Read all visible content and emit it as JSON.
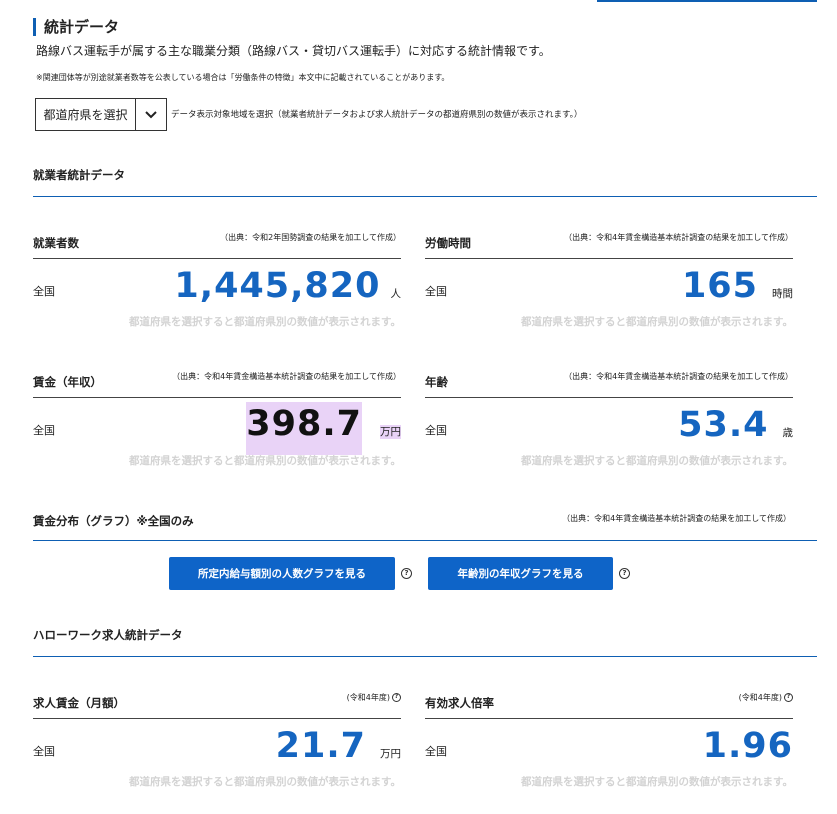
{
  "header": {
    "title": "統計データ",
    "description": "路線バス運転手が属する主な職業分類（路線バス・貸切バス運転手）に対応する統計情報です。",
    "note": "※関連団体等が別途就業者数等を公表している場合は「労働条件の特徴」本文中に記載されていることがあります。"
  },
  "region_select": {
    "label": "都道府県を選択",
    "hint": "データ表示対象地域を選択（就業者統計データおよび求人統計データの都道府県別の数値が表示されます。）"
  },
  "employment_section": {
    "title": "就業者統計データ"
  },
  "cards": {
    "workers": {
      "title": "就業者数",
      "source": "（出典：令和2年国勢調査の結果を加工して作成）",
      "region": "全国",
      "value": "1,445,820",
      "unit": "人",
      "note": "都道府県を選択すると都道府県別の数値が表示されます。"
    },
    "hours": {
      "title": "労働時間",
      "source": "（出典：令和4年賃金構造基本統計調査の結果を加工して作成）",
      "region": "全国",
      "value": "165",
      "unit": "時間",
      "note": "都道府県を選択すると都道府県別の数値が表示されます。"
    },
    "wage": {
      "title": "賃金（年収）",
      "source": "（出典：令和4年賃金構造基本統計調査の結果を加工して作成）",
      "region": "全国",
      "value": "398.7",
      "unit": "万円",
      "note": "都道府県を選択すると都道府県別の数値が表示されます。"
    },
    "age": {
      "title": "年齢",
      "source": "（出典：令和4年賃金構造基本統計調査の結果を加工して作成）",
      "region": "全国",
      "value": "53.4",
      "unit": "歳",
      "note": "都道府県を選択すると都道府県別の数値が表示されます。"
    },
    "job_wage": {
      "title": "求人賃金（月額）",
      "source": "(令和4年度)",
      "region": "全国",
      "value": "21.7",
      "unit": "万円",
      "note": "都道府県を選択すると都道府県別の数値が表示されます。"
    },
    "job_ratio": {
      "title": "有効求人倍率",
      "source": "(令和4年度)",
      "region": "全国",
      "value": "1.96",
      "unit": "",
      "note": "都道府県を選択すると都道府県別の数値が表示されます。"
    }
  },
  "distribution": {
    "title": "賃金分布（グラフ）※全国のみ",
    "source": "（出典：令和4年賃金構造基本統計調査の結果を加工して作成）",
    "button_by_salary": "所定内給与額別の人数グラフを見る",
    "button_by_age": "年齢別の年収グラフを見る"
  },
  "hellowork_section": {
    "title": "ハローワーク求人統計データ"
  },
  "icons": {
    "help": "?"
  },
  "colors": {
    "accent": "#0e5fb3",
    "value": "#1565c0",
    "button": "#0e64c8",
    "highlight": "#e9d3f7",
    "muted": "#d3d3d3"
  }
}
